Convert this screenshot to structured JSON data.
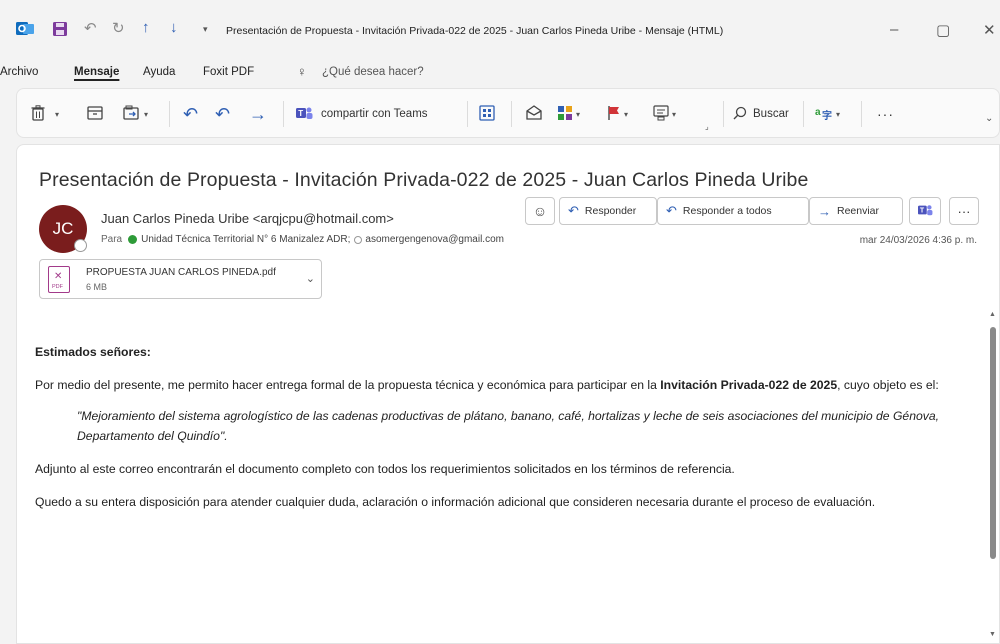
{
  "window": {
    "title": "Presentación de Propuesta - Invitación Privada-022 de 2025 - Juan Carlos Pineda Uribe  -  Mensaje (HTML)",
    "minimize": "–",
    "maximize": "▢",
    "close": "✕"
  },
  "menu": {
    "items": [
      "Archivo",
      "Mensaje",
      "Ayuda",
      "Foxit PDF"
    ],
    "active": "Mensaje",
    "search_prompt": "¿Qué desea hacer?"
  },
  "ribbon": {
    "teams_label": "compartir con Teams",
    "search_label": "Buscar",
    "more_label": "···"
  },
  "message": {
    "subject": "Presentación de Propuesta - Invitación Privada-022 de 2025 - Juan Carlos Pineda Uribe",
    "avatar_initials": "JC",
    "sender": "Juan Carlos Pineda Uribe <arqjcpu@hotmail.com>",
    "to_label": "Para",
    "recipient_1": "Unidad Técnica Territorial N° 6 Manizalez ADR;",
    "recipient_2": "asomergengenova@gmail.com",
    "date": "mar 24/03/2026 4:36 p. m.",
    "actions": {
      "reply": "Responder",
      "reply_all": "Responder a todos",
      "forward": "Reenviar",
      "more": "···"
    },
    "attachment": {
      "name": "PROPUESTA JUAN CARLOS PINEDA.pdf",
      "size": "6 MB",
      "type_label": "PDF"
    },
    "body": {
      "greeting": "Estimados señores:",
      "p1_a": "Por medio del presente, me permito hacer entrega formal de la propuesta técnica y económica para participar en la ",
      "p1_bold": "Invitación Privada-022 de 2025",
      "p1_b": ", cuyo objeto es el:",
      "quote": "\"Mejoramiento del sistema agrologístico de las cadenas productivas de plátano, banano, café, hortalizas y leche de seis asociaciones del municipio de Génova, Departamento del Quindío\".",
      "p2": "Adjunto al este correo encontrarán el documento completo con todos los requerimientos solicitados en los términos de referencia.",
      "p3": "Quedo a su entera disposición para atender cualquier duda, aclaración o información adicional que consideren necesaria durante el proceso de evaluación."
    }
  },
  "colors": {
    "avatar_bg": "#7a1d1d",
    "accent_blue": "#2f5fb3",
    "presence_green": "#2e9b38",
    "pdf_magenta": "#a23a8a"
  }
}
